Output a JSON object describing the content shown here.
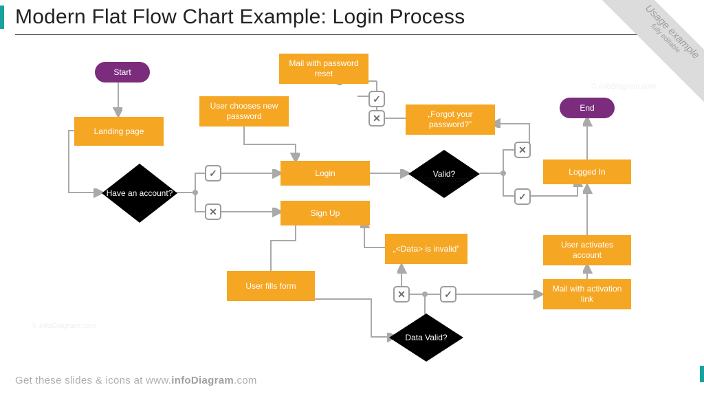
{
  "title": "Modern Flat Flow Chart Example: Login Process",
  "footer_prefix": "Get these slides & icons at www.",
  "footer_bold": "infoDiagram",
  "footer_suffix": ".com",
  "ribbon": {
    "line1": "Usage example",
    "line2": "fully editable"
  },
  "watermark": "© infoDiagram.com",
  "colors": {
    "process": "#f5a623",
    "decision": "#1798c1",
    "terminator": "#7b2c7d",
    "connector": "#a9a9a9",
    "accent": "#17a29b"
  },
  "nodes": {
    "start": {
      "type": "terminator",
      "label": "Start"
    },
    "end": {
      "type": "terminator",
      "label": "End"
    },
    "landing": {
      "type": "process",
      "label": "Landing page"
    },
    "have_account": {
      "type": "decision",
      "label": "Have an account?"
    },
    "user_new_pw": {
      "type": "process",
      "label": "User chooses new password"
    },
    "mail_reset": {
      "type": "process",
      "label": "Mail with password reset"
    },
    "login": {
      "type": "process",
      "label": "Login"
    },
    "signup": {
      "type": "process",
      "label": "Sign Up"
    },
    "user_fills": {
      "type": "process",
      "label": "User fills form"
    },
    "forgot_pw": {
      "type": "process",
      "label": "„Forgot your password?”"
    },
    "valid": {
      "type": "decision",
      "label": "Valid?"
    },
    "data_invalid": {
      "type": "process",
      "label": "„<Data> is invalid”"
    },
    "data_valid": {
      "type": "decision",
      "label": "Data Valid?"
    },
    "logged_in": {
      "type": "process",
      "label": "Logged In"
    },
    "activates": {
      "type": "process",
      "label": "User activates account"
    },
    "mail_act": {
      "type": "process",
      "label": "Mail with activation link"
    }
  },
  "checkmarks": {
    "yes": "✓",
    "no": "✕"
  },
  "chart_data": {
    "type": "flowchart",
    "title": "Login Process",
    "nodes": [
      {
        "id": "start",
        "kind": "terminator",
        "label": "Start"
      },
      {
        "id": "landing",
        "kind": "process",
        "label": "Landing page"
      },
      {
        "id": "have_account",
        "kind": "decision",
        "label": "Have an account?"
      },
      {
        "id": "login",
        "kind": "process",
        "label": "Login"
      },
      {
        "id": "signup",
        "kind": "process",
        "label": "Sign Up"
      },
      {
        "id": "user_fills",
        "kind": "process",
        "label": "User fills form"
      },
      {
        "id": "data_valid",
        "kind": "decision",
        "label": "Data Valid?"
      },
      {
        "id": "data_invalid",
        "kind": "process",
        "label": "„<Data> is invalid”"
      },
      {
        "id": "mail_act",
        "kind": "process",
        "label": "Mail with activation link"
      },
      {
        "id": "activates",
        "kind": "process",
        "label": "User activates account"
      },
      {
        "id": "valid",
        "kind": "decision",
        "label": "Valid?"
      },
      {
        "id": "forgot_pw",
        "kind": "process",
        "label": "„Forgot your password?”"
      },
      {
        "id": "mail_reset",
        "kind": "process",
        "label": "Mail with password reset"
      },
      {
        "id": "user_new_pw",
        "kind": "process",
        "label": "User chooses new password"
      },
      {
        "id": "logged_in",
        "kind": "process",
        "label": "Logged In"
      },
      {
        "id": "end",
        "kind": "terminator",
        "label": "End"
      }
    ],
    "edges": [
      {
        "from": "start",
        "to": "landing"
      },
      {
        "from": "landing",
        "to": "have_account"
      },
      {
        "from": "have_account",
        "to": "login",
        "label": "yes"
      },
      {
        "from": "have_account",
        "to": "signup",
        "label": "no"
      },
      {
        "from": "signup",
        "to": "user_fills"
      },
      {
        "from": "user_fills",
        "to": "data_valid"
      },
      {
        "from": "data_valid",
        "to": "data_invalid",
        "label": "no"
      },
      {
        "from": "data_invalid",
        "to": "signup"
      },
      {
        "from": "data_valid",
        "to": "mail_act",
        "label": "yes"
      },
      {
        "from": "mail_act",
        "to": "activates"
      },
      {
        "from": "activates",
        "to": "logged_in"
      },
      {
        "from": "login",
        "to": "valid"
      },
      {
        "from": "valid",
        "to": "logged_in",
        "label": "yes"
      },
      {
        "from": "valid",
        "to": "forgot_pw",
        "label": "no"
      },
      {
        "from": "forgot_pw",
        "to": "mail_reset"
      },
      {
        "from": "mail_reset",
        "to": "user_new_pw"
      },
      {
        "from": "user_new_pw",
        "to": "login"
      },
      {
        "from": "logged_in",
        "to": "end"
      }
    ]
  }
}
